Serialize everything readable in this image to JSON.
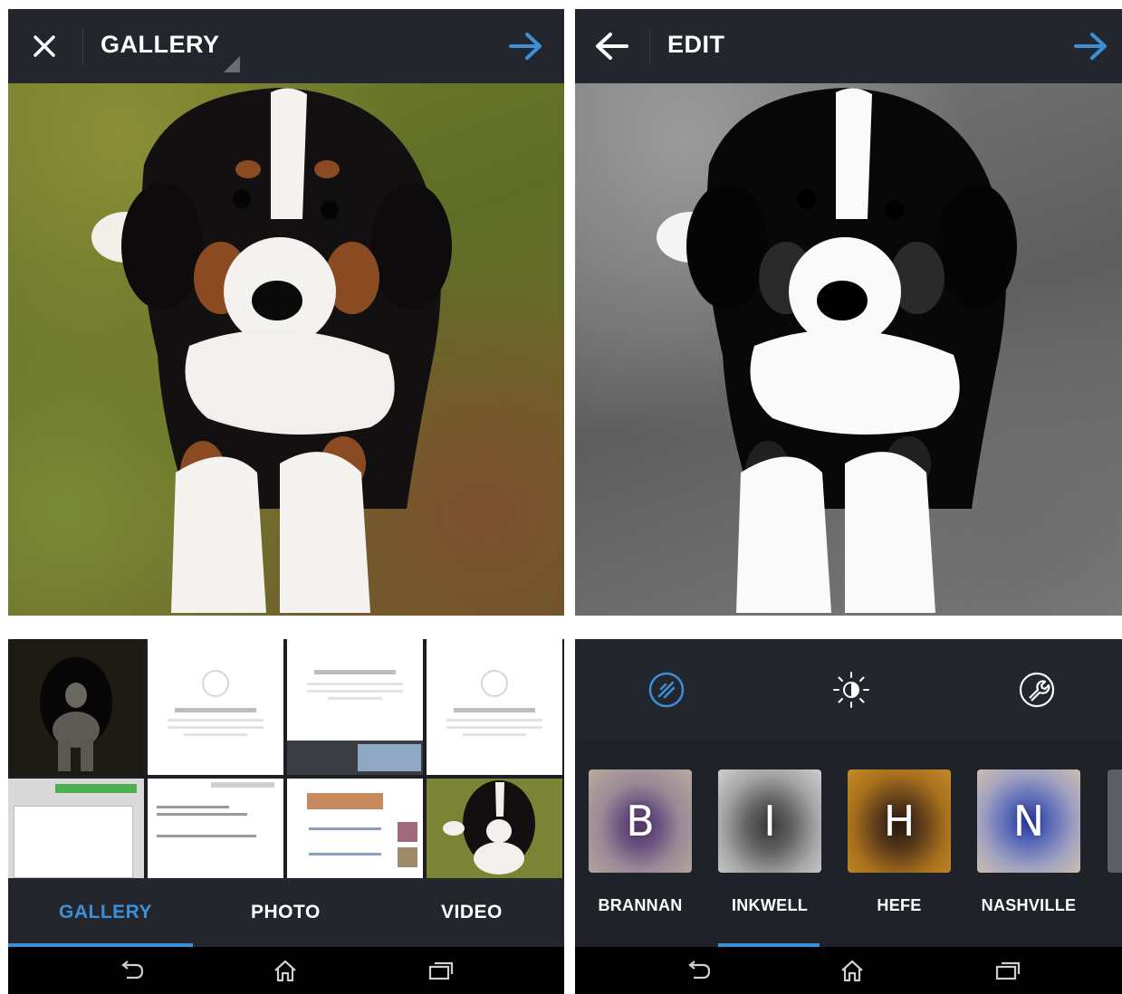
{
  "gallery_screen": {
    "header": {
      "title": "GALLERY",
      "close_icon": "close-icon",
      "next_icon": "arrow-right-icon"
    },
    "tabs": [
      {
        "label": "GALLERY",
        "selected": true
      },
      {
        "label": "PHOTO",
        "selected": false
      },
      {
        "label": "VIDEO",
        "selected": false
      }
    ]
  },
  "edit_screen": {
    "header": {
      "title": "EDIT",
      "back_icon": "arrow-left-icon",
      "next_icon": "arrow-right-icon"
    },
    "tools": [
      {
        "icon": "magic-wand-icon",
        "selected": true
      },
      {
        "icon": "brightness-icon",
        "selected": false
      },
      {
        "icon": "wrench-icon",
        "selected": false
      }
    ],
    "filters": [
      {
        "letter": "B",
        "label": "BRANNAN",
        "selected": false
      },
      {
        "letter": "I",
        "label": "INKWELL",
        "selected": true
      },
      {
        "letter": "H",
        "label": "HEFE",
        "selected": false
      },
      {
        "letter": "N",
        "label": "NASHVILLE",
        "selected": false
      }
    ]
  },
  "colors": {
    "accent": "#3d8fd8",
    "bar_background": "#23262d",
    "panel_background": "#1f2229",
    "nav_background": "#000000"
  }
}
